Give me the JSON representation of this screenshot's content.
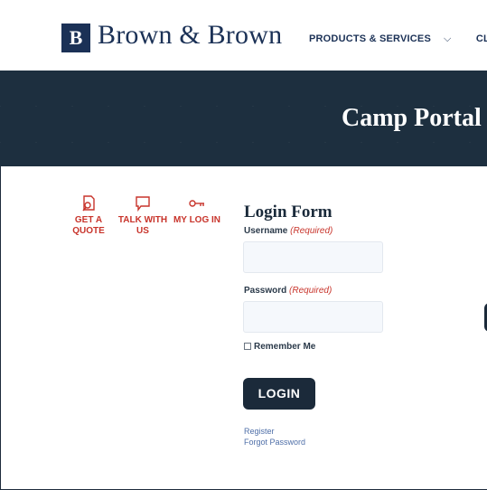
{
  "header": {
    "logo_mark": "B",
    "logo_text": "Brown & Brown",
    "nav": [
      {
        "label": "PRODUCTS & SERVICES",
        "chevron": "⌵"
      },
      {
        "label": "CL",
        "chevron": ""
      }
    ]
  },
  "banner": {
    "title": "Camp Portal"
  },
  "quick_actions": [
    {
      "label": "GET A QUOTE",
      "icon": "magnifier-document-icon"
    },
    {
      "label": "TALK WITH US",
      "icon": "speech-bubble-icon"
    },
    {
      "label": "MY LOG IN",
      "icon": "key-icon"
    }
  ],
  "login_form": {
    "title": "Login Form",
    "username_label": "Username",
    "password_label": "Password",
    "required_text": "(Required)",
    "username_value": "",
    "password_value": "",
    "remember_label": "Remember Me",
    "remember_checked": false,
    "submit_label": "LOGIN",
    "register_link": "Register",
    "forgot_link": "Forgot Password"
  },
  "colors": {
    "navy": "#1b3156",
    "banner": "#1d2f3f",
    "accent_red": "#c8342b",
    "button": "#1b2a3a",
    "link": "#4f6fa8"
  }
}
